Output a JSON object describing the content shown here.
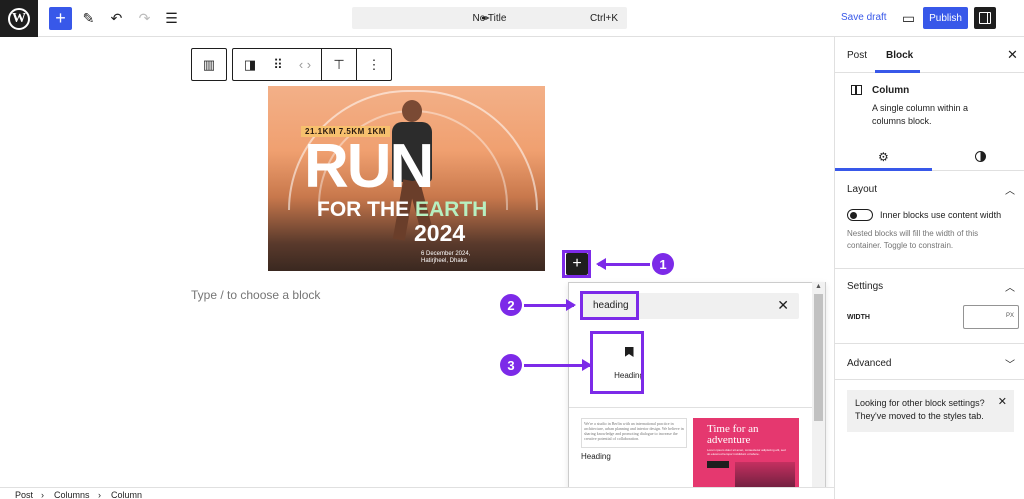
{
  "topbar": {
    "logo_letter": "W",
    "doc_title": "No Title",
    "shortcut": "Ctrl+K",
    "save_draft": "Save draft",
    "publish": "Publish"
  },
  "poster": {
    "distances": "21.1KM  7.5KM  1KM",
    "title_line1": "RUN",
    "title_line2_a": "FOR THE ",
    "title_line2_b": "EARTH",
    "year": "2024",
    "date_line1": "6 December 2024,",
    "date_line2": "Hatirjheel, Dhaka"
  },
  "canvas": {
    "placeholder": "Type / to choose a block"
  },
  "annotations": {
    "n1": "1",
    "n2": "2",
    "n3": "3"
  },
  "inserter": {
    "search_value": "heading",
    "result_label": "Heading",
    "pattern1_text": "We're a studio in Berlin with an international practice in architecture, urban planning and interior design. We believe in sharing knowledge and promoting dialogue to increase the creative potential of collaboration.",
    "pattern1_label": "Heading",
    "pattern2_title": "Time for an adventure",
    "pattern2_desc": "Lorem ipsum dolor sit amet, consectetur adipiscing elit, sed do eiusmod tempor incididunt ut labore."
  },
  "breadcrumb": [
    "Post",
    "Columns",
    "Column"
  ],
  "sidebar": {
    "tabs": [
      "Post",
      "Block"
    ],
    "block_title": "Column",
    "block_desc": "A single column within a columns block.",
    "layout_title": "Layout",
    "toggle_label": "Inner blocks use content width",
    "layout_help": "Nested blocks will fill the width of this container. Toggle to constrain.",
    "settings_title": "Settings",
    "width_label": "WIDTH",
    "width_unit": "PX",
    "advanced_title": "Advanced",
    "notice": "Looking for other block settings? They've moved to the styles tab."
  },
  "colors": {
    "accent": "#3858e9",
    "annotation": "#7c2ae8"
  }
}
